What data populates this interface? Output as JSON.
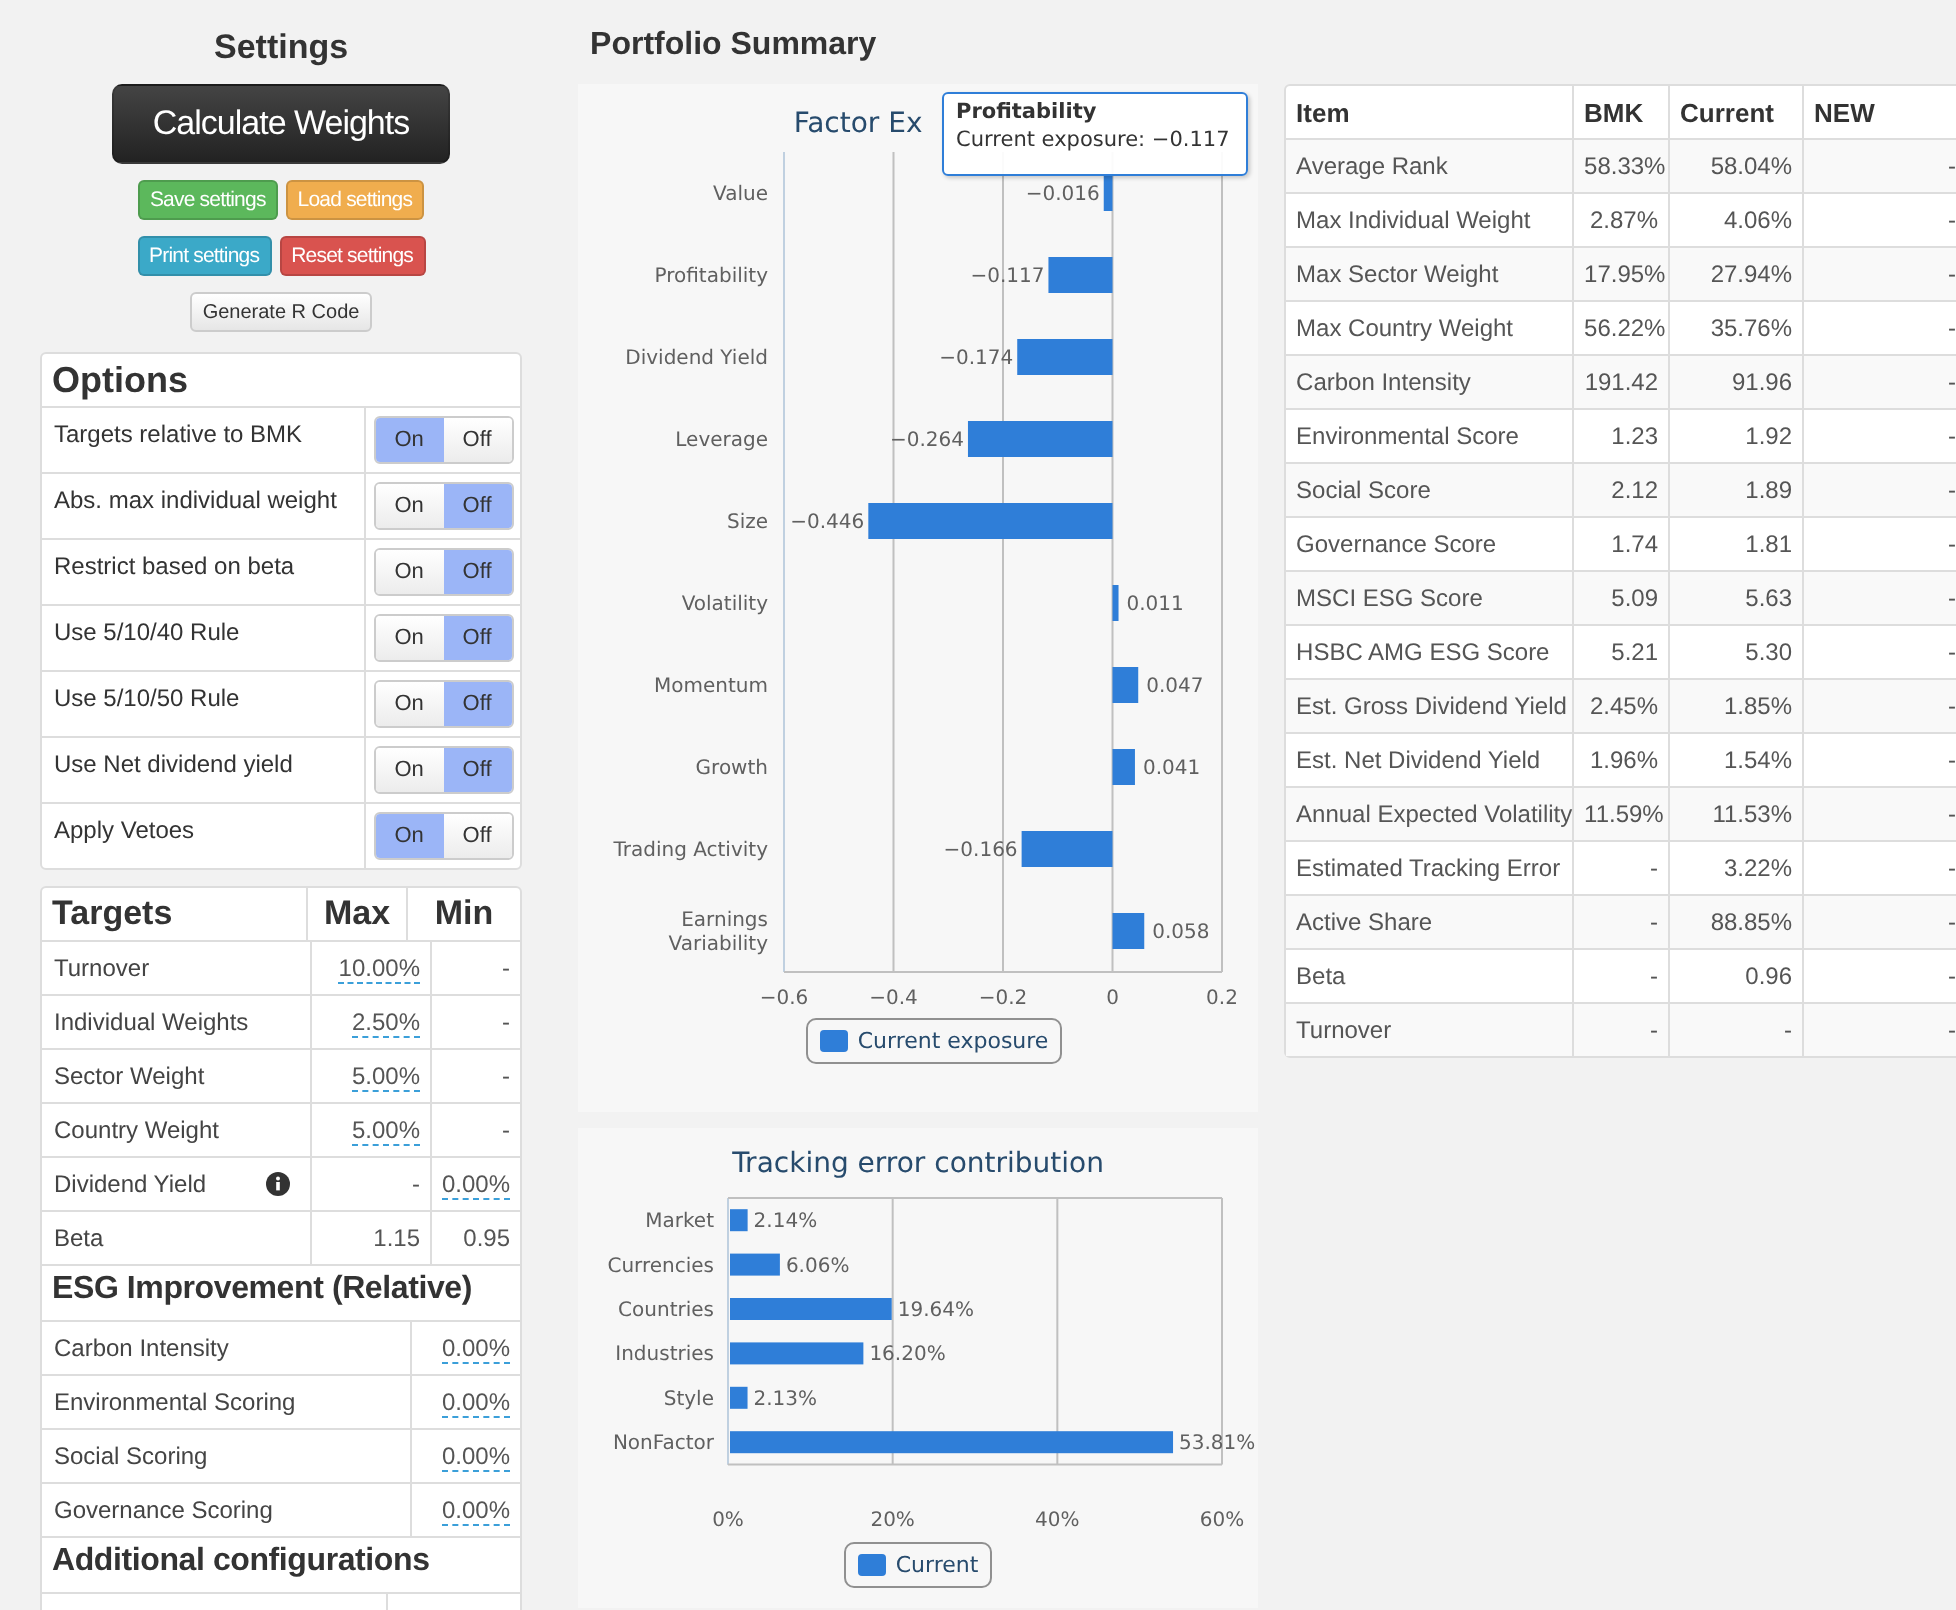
{
  "settings": {
    "title": "Settings",
    "buttons": [
      {
        "label": "Calculate Weights",
        "kind": "dark"
      },
      {
        "label": "Save settings",
        "kind": "success"
      },
      {
        "label": "Load settings",
        "kind": "warning"
      },
      {
        "label": "Print settings",
        "kind": "info"
      },
      {
        "label": "Reset settings",
        "kind": "danger"
      },
      {
        "label": "Generate R Code",
        "kind": "default"
      }
    ],
    "options": {
      "title": "Options",
      "items": [
        {
          "label": "Targets relative to BMK",
          "on_label": "On",
          "off_label": "Off",
          "on": true
        },
        {
          "label": "Abs. max individual weight",
          "on_label": "On",
          "off_label": "Off",
          "on": false
        },
        {
          "label": "Restrict based on beta",
          "on_label": "On",
          "off_label": "Off",
          "on": false
        },
        {
          "label": "Use 5/10/40 Rule",
          "on_label": "On",
          "off_label": "Off",
          "on": false
        },
        {
          "label": "Use 5/10/50 Rule",
          "on_label": "On",
          "off_label": "Off",
          "on": false
        },
        {
          "label": "Use Net dividend yield",
          "on_label": "On",
          "off_label": "Off",
          "on": false
        },
        {
          "label": "Apply Vetoes",
          "on_label": "On",
          "off_label": "Off",
          "on": true
        }
      ]
    },
    "targets": {
      "title": "Targets",
      "columns": [
        "Max",
        "Min"
      ],
      "rows": [
        {
          "label": "Turnover",
          "info": false,
          "max": {
            "text": "10.00%",
            "editable": true
          },
          "min": {
            "text": "-",
            "editable": false
          }
        },
        {
          "label": "Individual Weights",
          "info": false,
          "max": {
            "text": "2.50%",
            "editable": true
          },
          "min": {
            "text": "-",
            "editable": false
          }
        },
        {
          "label": "Sector Weight",
          "info": false,
          "max": {
            "text": "5.00%",
            "editable": true
          },
          "min": {
            "text": "-",
            "editable": false
          }
        },
        {
          "label": "Country Weight",
          "info": false,
          "max": {
            "text": "5.00%",
            "editable": true
          },
          "min": {
            "text": "-",
            "editable": false
          }
        },
        {
          "label": "Dividend Yield",
          "info": true,
          "max": {
            "text": "-",
            "editable": false
          },
          "min": {
            "text": "0.00%",
            "editable": true
          }
        },
        {
          "label": "Beta",
          "info": false,
          "max": {
            "text": "1.15",
            "editable": false
          },
          "min": {
            "text": "0.95",
            "editable": false
          }
        }
      ]
    },
    "esg": {
      "title": "ESG Improvement (Relative)",
      "rows": [
        {
          "label": "Carbon Intensity",
          "value": {
            "text": "0.00%",
            "editable": true
          }
        },
        {
          "label": "Environmental Scoring",
          "value": {
            "text": "0.00%",
            "editable": true
          }
        },
        {
          "label": "Social Scoring",
          "value": {
            "text": "0.00%",
            "editable": true
          }
        },
        {
          "label": "Governance Scoring",
          "value": {
            "text": "0.00%",
            "editable": true
          }
        }
      ]
    },
    "additional": {
      "title": "Additional configurations"
    }
  },
  "portfolio": {
    "title": "Portfolio Summary",
    "factor_chart": {
      "tooltip": {
        "title": "Profitability",
        "text": "Current exposure: −0.117"
      },
      "chart_data": {
        "type": "bar",
        "orientation": "horizontal",
        "grid": true,
        "title": "Factor Ex",
        "categories": [
          "Value",
          "Profitability",
          "Dividend Yield",
          "Leverage",
          "Size",
          "Volatility",
          "Momentum",
          "Growth",
          "Trading Activity",
          "Earnings Variability"
        ],
        "series": [
          {
            "name": "Current exposure",
            "color": "#2f7ed8",
            "values": [
              -0.016,
              -0.117,
              -0.174,
              -0.264,
              -0.446,
              0.011,
              0.047,
              0.041,
              -0.166,
              0.058
            ]
          }
        ],
        "value_labels": [
          "−0.016",
          "−0.117",
          "−0.174",
          "−0.264",
          "−0.446",
          "0.011",
          "0.047",
          "0.041",
          "−0.166",
          "0.058"
        ],
        "xlim": [
          -0.6,
          0.2
        ],
        "xticks": [
          {
            "value": -0.6,
            "label": "−0.6"
          },
          {
            "value": -0.4,
            "label": "−0.4"
          },
          {
            "value": -0.2,
            "label": "−0.2"
          },
          {
            "value": 0,
            "label": "0"
          },
          {
            "value": 0.2,
            "label": "0.2"
          }
        ]
      }
    },
    "tracking_chart": {
      "chart_data": {
        "type": "bar",
        "orientation": "horizontal",
        "grid": true,
        "title": "Tracking error contribution",
        "categories": [
          "Market",
          "Currencies",
          "Countries",
          "Industries",
          "Style",
          "NonFactor"
        ],
        "series": [
          {
            "name": "Current",
            "color": "#2f7ed8",
            "values": [
              2.14,
              6.06,
              19.64,
              16.2,
              2.13,
              53.81
            ]
          }
        ],
        "value_labels": [
          "2.14%",
          "6.06%",
          "19.64%",
          "16.20%",
          "2.13%",
          "53.81%"
        ],
        "xlim": [
          0,
          60
        ],
        "xticks": [
          {
            "value": 0,
            "label": "0%"
          },
          {
            "value": 20,
            "label": "20%"
          },
          {
            "value": 40,
            "label": "40%"
          },
          {
            "value": 60,
            "label": "60%"
          }
        ]
      }
    },
    "table": {
      "columns": [
        "Item",
        "BMK",
        "Current",
        "NEW"
      ],
      "rows": [
        [
          "Average Rank",
          "58.33%",
          "58.04%",
          "-"
        ],
        [
          "Max Individual Weight",
          "2.87%",
          "4.06%",
          "-"
        ],
        [
          "Max Sector Weight",
          "17.95%",
          "27.94%",
          "-"
        ],
        [
          "Max Country Weight",
          "56.22%",
          "35.76%",
          "-"
        ],
        [
          "Carbon Intensity",
          "191.42",
          "91.96",
          "-"
        ],
        [
          "Environmental Score",
          "1.23",
          "1.92",
          "-"
        ],
        [
          "Social Score",
          "2.12",
          "1.89",
          "-"
        ],
        [
          "Governance Score",
          "1.74",
          "1.81",
          "-"
        ],
        [
          "MSCI ESG Score",
          "5.09",
          "5.63",
          "-"
        ],
        [
          "HSBC AMG ESG Score",
          "5.21",
          "5.30",
          "-"
        ],
        [
          "Est. Gross Dividend Yield",
          "2.45%",
          "1.85%",
          "-"
        ],
        [
          "Est. Net Dividend Yield",
          "1.96%",
          "1.54%",
          "-"
        ],
        [
          "Annual Expected Volatility",
          "11.59%",
          "11.53%",
          "-"
        ],
        [
          "Estimated Tracking Error",
          "-",
          "3.22%",
          "-"
        ],
        [
          "Active Share",
          "-",
          "88.85%",
          "-"
        ],
        [
          "Beta",
          "-",
          "0.96",
          "-"
        ],
        [
          "Turnover",
          "-",
          "-",
          "-"
        ]
      ]
    }
  }
}
